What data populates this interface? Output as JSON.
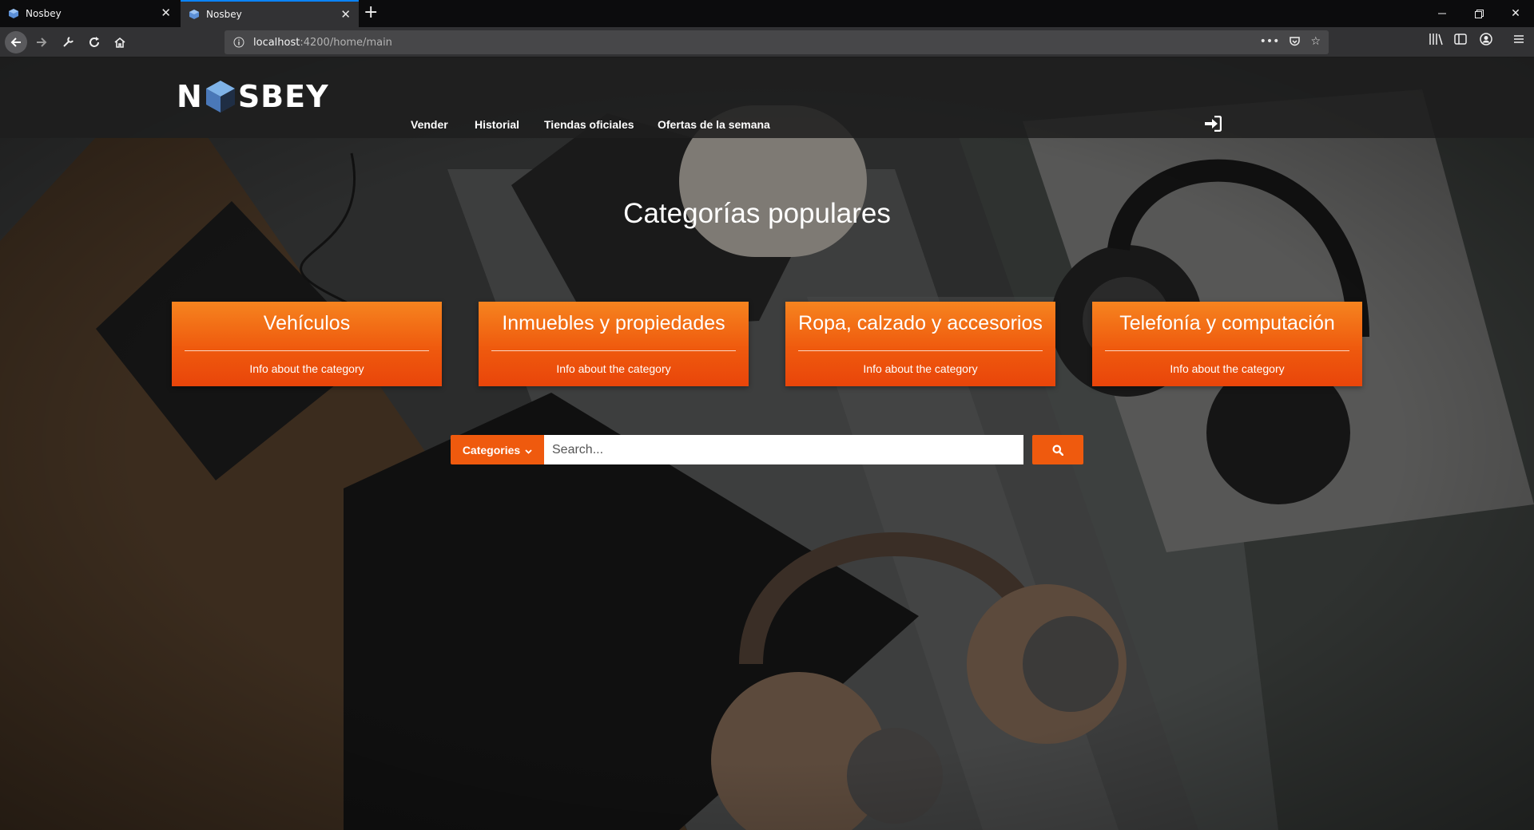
{
  "browser": {
    "tabs": [
      {
        "title": "Nosbey",
        "active": false
      },
      {
        "title": "Nosbey",
        "active": true
      }
    ],
    "url_host": "localhost",
    "url_path": ":4200/home/main",
    "accent_color": "#0a84ff"
  },
  "site": {
    "logo_left": "N",
    "logo_right": "SBEY",
    "menu": [
      "Vender",
      "Historial",
      "Tiendas oficiales",
      "Ofertas de la semana"
    ],
    "login_icon": "sign-in-icon"
  },
  "main": {
    "title": "Categorías populares",
    "categories": [
      {
        "name": "Vehículos",
        "info": "Info about the category"
      },
      {
        "name": "Inmuebles y propiedades",
        "info": "Info about the category"
      },
      {
        "name": "Ropa, calzado y accesorios",
        "info": "Info about the category"
      },
      {
        "name": "Telefonía y computación",
        "info": "Info about the category"
      }
    ],
    "search": {
      "categories_label": "Categories",
      "placeholder": "Search..."
    },
    "accent_color": "#ef5a0e"
  }
}
